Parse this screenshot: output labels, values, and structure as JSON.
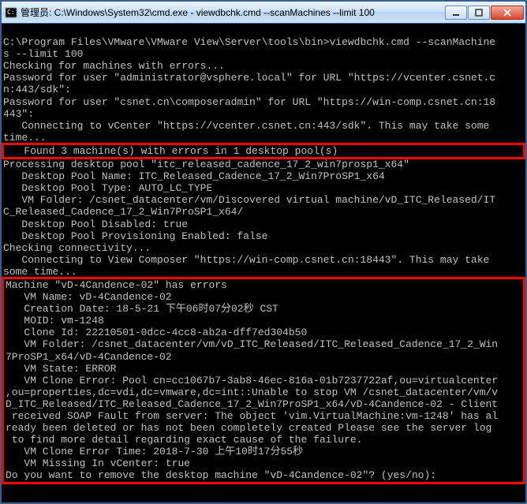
{
  "titlebar": {
    "title": "管理员: C:\\Windows\\System32\\cmd.exe - viewdbchk.cmd  --scanMachines --limit 100"
  },
  "console": {
    "line01": "C:\\Program Files\\VMware\\VMware View\\Server\\tools\\bin>viewdbchk.cmd --scanMachine",
    "line02": "s --limit 100",
    "line03": "Checking for machines with errors...",
    "line04": "Password for user \"administrator@vsphere.local\" for URL \"https://vcenter.csnet.c",
    "line05": "n:443/sdk\":",
    "line06": "Password for user \"csnet.cn\\composeradmin\" for URL \"https://win-comp.csnet.cn:18",
    "line07": "443\":",
    "line08": "   Connecting to vCenter \"https://vcenter.csnet.cn:443/sdk\". This may take some",
    "line09": "time...",
    "line10": "   Found 3 machine(s) with errors in 1 desktop pool(s)",
    "line11": "Processing desktop pool \"itc_released_cadence_17_2_win7prosp1_x64\"",
    "line12": "   Desktop Pool Name: ITC_Released_Cadence_17_2_Win7ProSP1_x64",
    "line13": "   Desktop Pool Type: AUTO_LC_TYPE",
    "line14": "   VM Folder: /csnet_datacenter/vm/Discovered virtual machine/vD_ITC_Released/IT",
    "line15": "C_Released_Cadence_17_2_Win7ProSP1_x64/",
    "line16": "   Desktop Pool Disabled: true",
    "line17": "   Desktop Pool Provisioning Enabled: false",
    "line18": "Checking connectivity...",
    "line19": "   Connecting to View Composer \"https://win-comp.csnet.cn:18443\". This may take",
    "line20": "some time...",
    "line21": "Machine \"vD-4Candence-02\" has errors",
    "line22": "   VM Name: vD-4Candence-02",
    "line23": "   Creation Date: 18-5-21 下午06时07分02秒 CST",
    "line24": "   MOID: vm-1248",
    "line25": "   Clone Id: 22210501-0dcc-4cc8-ab2a-dff7ed304b50",
    "line26": "   VM Folder: /csnet_datacenter/vm/vD_ITC_Released/ITC_Released_Cadence_17_2_Win",
    "line27": "7ProSP1_x64/vD-4Candence-02",
    "line28": "   VM State: ERROR",
    "line29": "   VM Clone Error: Pool cn=cc1067b7-3ab8-46ec-816a-01b7237722af,ou=virtualcenter",
    "line30": ",ou=properties,dc=vdi,dc=vmware,dc=int::Unable to stop VM /csnet_datacenter/vm/v",
    "line31": "D_ITC_Released/ITC_Released_Cadence_17_2_Win7ProSP1_x64/vD-4Candence-02 - Client",
    "line32": " received SOAP Fault from server: The object 'vim.VirtualMachine:vm-1248' has al",
    "line33": "ready been deleted or has not been completely created Please see the server log",
    "line34": " to find more detail regarding exact cause of the failure.",
    "line35": "   VM Clone Error Time: 2018-7-30 上午10时17分55秒",
    "line36": "   VM Missing In vCenter: true",
    "line37": "Do you want to remove the desktop machine \"vD-4Candence-02\"? (yes/no):"
  }
}
